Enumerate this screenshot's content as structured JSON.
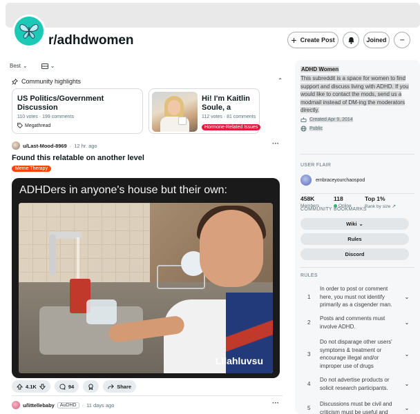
{
  "subreddit": {
    "name": "r/adhdwomen"
  },
  "header": {
    "create_post": "Create Post",
    "joined": "Joined",
    "more": "···"
  },
  "feed": {
    "sort": "Best",
    "highlights": {
      "title": "Community highlights",
      "cards": [
        {
          "title": "US Politics/Government Discussion",
          "votes": "110 votes",
          "comments": "199 comments",
          "tag": "Megathread"
        },
        {
          "title": "Hi! I'm Kaitlin Soule, a licensed therapist an...",
          "votes": "112 votes",
          "comments": "81 comments",
          "flair": "Hormone-Related Issues"
        }
      ]
    },
    "posts": [
      {
        "user": "u/Last-Mood-8969",
        "time": "12 hr. ago",
        "title": "Found this relatable on another level",
        "flair": "Meme Therapy",
        "media_caption": "ADHDers in anyone's house but their own:",
        "watermark": "Lilahluvsu",
        "upvotes": "4.1K",
        "comments": "94",
        "share": "Share"
      },
      {
        "user": "u/littellebaby",
        "user_flair": "AuDHD",
        "time": "11 days ago"
      }
    ]
  },
  "sidebar": {
    "title": "ADHD Women",
    "description": "This subreddit is a space for women to find support and discuss living with ADHD. If you would like to contact the mods, send us a modmail instead of DM-ing the moderators directly.",
    "created": "Created Apr 9, 2014",
    "visibility": "Public",
    "stats": [
      {
        "value": "458K",
        "label": "Members"
      },
      {
        "value": "118",
        "label": "Online"
      },
      {
        "value": "Top 1%",
        "label": "Rank by size"
      }
    ],
    "user_flair_heading": "USER FLAIR",
    "user_flair_name": "embraceyourchaospod",
    "bookmarks_heading": "COMMUNITY BOOKMARKS",
    "bookmarks": [
      "Wiki",
      "Rules",
      "Discord"
    ],
    "rules_heading": "RULES",
    "rules": [
      {
        "n": "1",
        "text": "In order to post or comment here, you must not identify primarily as a cisgender man."
      },
      {
        "n": "2",
        "text": "Posts and comments must involve ADHD."
      },
      {
        "n": "3",
        "text": "Do not disparage other users' symptoms & treatment or encourage illegal and/or improper use of drugs"
      },
      {
        "n": "4",
        "text": "Do not advertise products or solicit research participants."
      },
      {
        "n": "5",
        "text": "Discussions must be civil and criticism must be useful and"
      }
    ]
  },
  "colors": {
    "accent_teal": "#1bc9b6",
    "flair_orange": "#ff4500",
    "flair_red": "#e0193d",
    "online_green": "#2eb872"
  }
}
